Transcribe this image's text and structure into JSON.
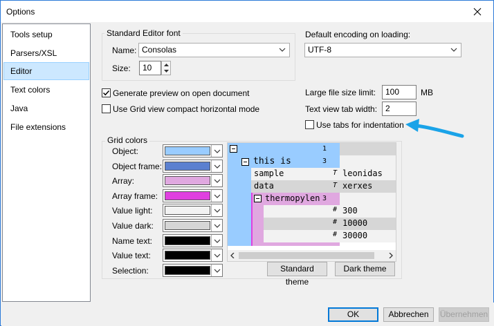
{
  "window": {
    "title": "Options"
  },
  "nav": {
    "items": [
      {
        "label": "Tools setup"
      },
      {
        "label": "Parsers/XSL"
      },
      {
        "label": "Editor"
      },
      {
        "label": "Text colors"
      },
      {
        "label": "Java"
      },
      {
        "label": "File extensions"
      }
    ],
    "selected": "Editor"
  },
  "font_group": {
    "legend": "Standard Editor font",
    "name_label": "Name:",
    "name_value": "Consolas",
    "size_label": "Size:",
    "size_value": "10"
  },
  "encoding": {
    "label": "Default encoding on loading:",
    "value": "UTF-8"
  },
  "options": {
    "generate_preview": {
      "label": "Generate preview on open document",
      "checked": true
    },
    "grid_compact": {
      "label": "Use Grid view compact horizontal mode",
      "checked": false
    },
    "use_tabs": {
      "label": "Use tabs for indentation",
      "checked": false
    }
  },
  "limits": {
    "large_file_label": "Large file size limit:",
    "large_file_value": "100",
    "large_file_unit": "MB",
    "tab_width_label": "Text view tab width:",
    "tab_width_value": "2"
  },
  "grid_colors": {
    "legend": "Grid colors",
    "items": [
      {
        "label": "Object:",
        "color": "#99ccff"
      },
      {
        "label": "Object frame:",
        "color": "#5b80d0"
      },
      {
        "label": "Array:",
        "color": "#e0a8e0"
      },
      {
        "label": "Array frame:",
        "color": "#e040e0"
      },
      {
        "label": "Value light:",
        "color": "#f2f2f2"
      },
      {
        "label": "Value dark:",
        "color": "#d6d6d6"
      },
      {
        "label": "Name text:",
        "color": "#000000"
      },
      {
        "label": "Value text:",
        "color": "#000000"
      },
      {
        "label": "Selection:",
        "color": "#000000"
      }
    ]
  },
  "preview": {
    "root_count": "1",
    "obj_label": "this is",
    "obj_count": "3",
    "rows": [
      {
        "name": "sample",
        "type": "T",
        "value": "leonidas"
      },
      {
        "name": "data",
        "type": "T",
        "value": "xerxes"
      }
    ],
    "array_label": "thermopylen",
    "array_count": "3",
    "array_items": [
      {
        "type": "#",
        "value": "300"
      },
      {
        "type": "#",
        "value": "10000"
      },
      {
        "type": "#",
        "value": "30000"
      }
    ]
  },
  "theme_buttons": {
    "standard": "Standard theme",
    "dark": "Dark theme"
  },
  "footer": {
    "ok": "OK",
    "cancel": "Abbrechen",
    "apply": "Übernehmen"
  },
  "colors": {
    "accent": "#0078d7",
    "selection_bg": "#cce8ff",
    "arrow": "#1aa3e8"
  }
}
